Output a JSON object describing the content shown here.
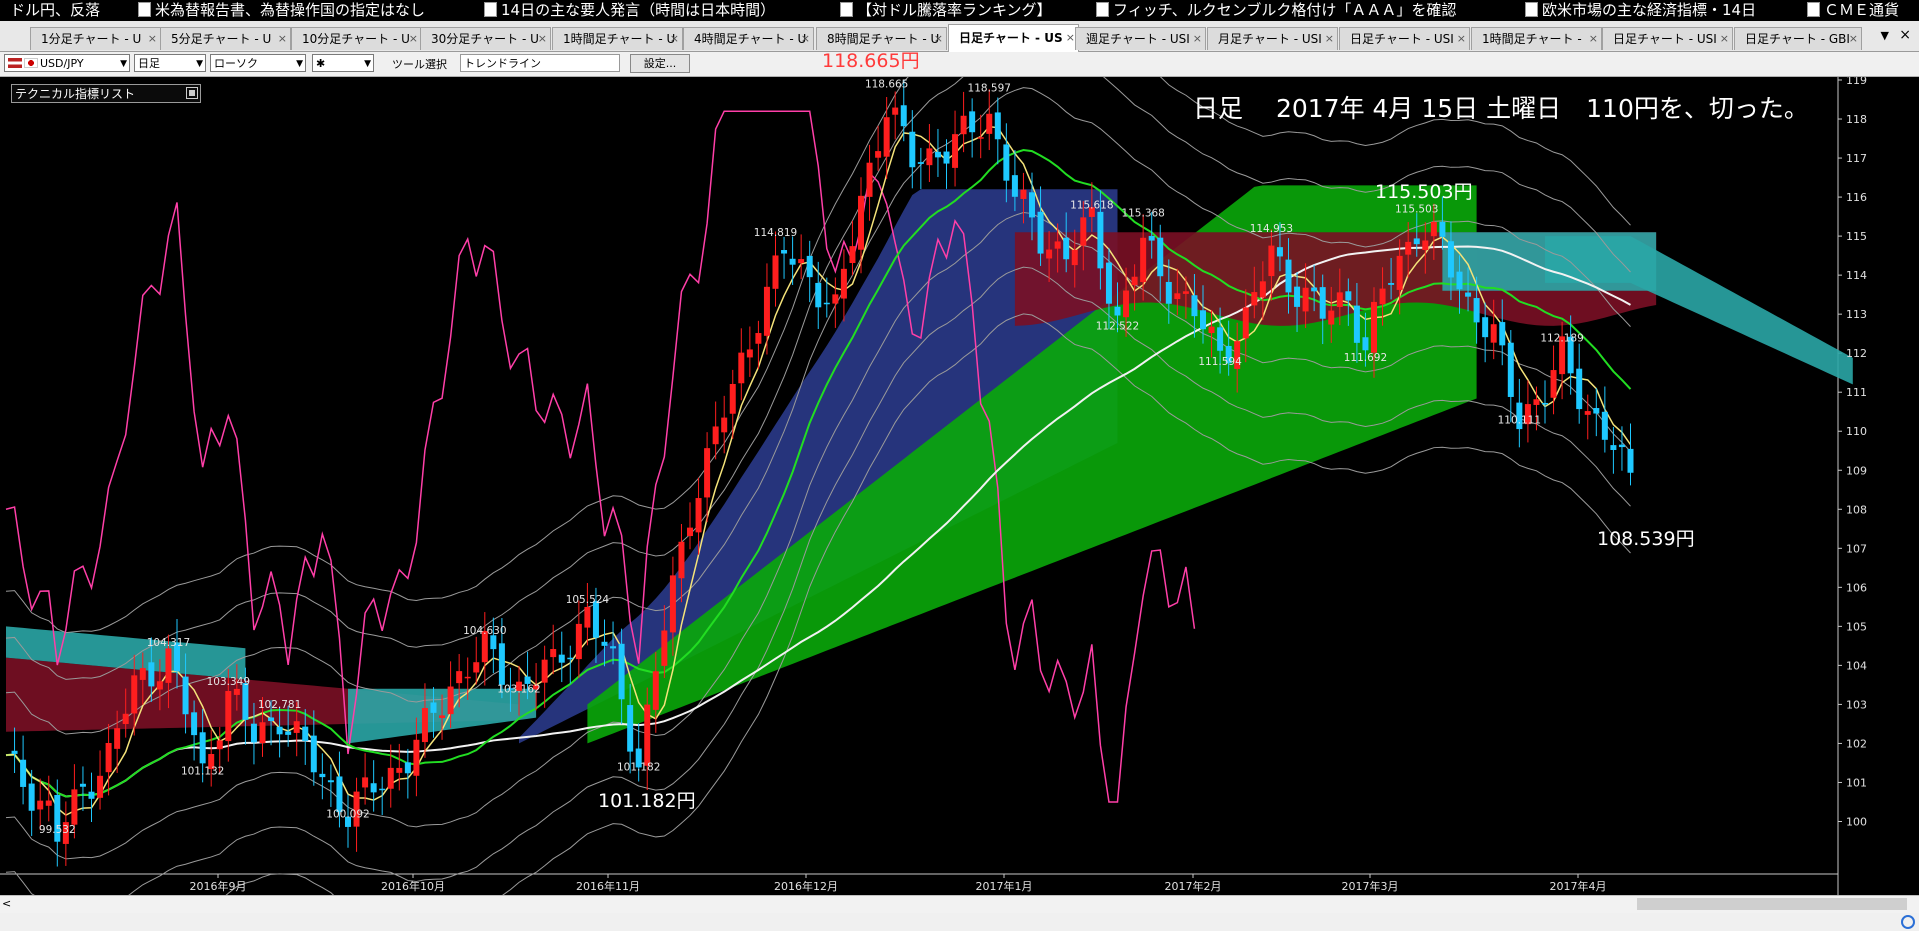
{
  "ticker": [
    {
      "text": "ドル円、反落",
      "icon": false
    },
    {
      "text": "米為替報告書、為替操作国の指定はなし",
      "icon": true
    },
    {
      "text": "14日の主な要人発言（時間は日本時間）",
      "icon": true
    },
    {
      "text": "【対ドル騰落率ランキング】",
      "icon": true
    },
    {
      "text": "フィッチ、ルクセンブルク格付け「ＡＡＡ」を確認",
      "icon": true
    },
    {
      "text": "欧米市場の主な経済指標・14日",
      "icon": true
    },
    {
      "text": "ＣＭＥ通貨",
      "icon": true
    }
  ],
  "tabs": [
    {
      "label": "1分足チャート - U",
      "active": false
    },
    {
      "label": "5分足チャート - U",
      "active": false
    },
    {
      "label": "10分足チャート - U",
      "active": false
    },
    {
      "label": "30分足チャート - U",
      "active": false
    },
    {
      "label": "1時間足チャート - U",
      "active": false
    },
    {
      "label": "4時間足チャート - U",
      "active": false
    },
    {
      "label": "8時間足チャート - U",
      "active": false
    },
    {
      "label": "日足チャート - US",
      "active": true
    },
    {
      "label": "週足チャート - USI",
      "active": false
    },
    {
      "label": "月足チャート - USI",
      "active": false
    },
    {
      "label": "日足チャート - USI",
      "active": false
    },
    {
      "label": "1時間足チャート -",
      "active": false
    },
    {
      "label": "日足チャート - USI",
      "active": false
    },
    {
      "label": "日足チャート - GBI",
      "active": false
    }
  ],
  "tab_close_glyph": "×",
  "tab_menu_glyph": "▼",
  "toolbar": {
    "pair": "USD/JPY",
    "period": "日足",
    "chart_style": "ローソク",
    "line_style": "✱",
    "tool_label": "ツール選択",
    "tool_value": "トレンドライン",
    "settings": "設定..."
  },
  "indicator_panel": {
    "label": "テクニカル指標リスト"
  },
  "annotations": {
    "headline": "日足　 2017年 4月 15日 土曜日　110円を、切った。",
    "high": "118.665円",
    "peak2": "115.503円",
    "low_nov": "101.182円",
    "current": "108.539円"
  },
  "colors": {
    "bull": "#ff1e1e",
    "bear": "#1ec8ff",
    "kumo_up": "#0aa80a",
    "kumo_down": "#7a1025",
    "cloud_blue": "#2a3a8a",
    "cloud_teal": "#2aa6a6",
    "rsi": "#ff3fa8",
    "ma_long": "#f2f2f2",
    "ma_mid": "#22dd22",
    "ma_short": "#f5e37a"
  },
  "chart_data": {
    "type": "candlestick",
    "instrument": "USD/JPY",
    "timeframe": "日足",
    "ylim": [
      99.5,
      119
    ],
    "y_ticks": [
      "100",
      "101",
      "102",
      "103",
      "104",
      "105",
      "106",
      "107",
      "108",
      "109",
      "110",
      "111",
      "112",
      "113",
      "114",
      "115",
      "116",
      "117",
      "118",
      "119"
    ],
    "x_ticks": [
      "2016年9月",
      "2016年10月",
      "2016年11月",
      "2016年12月",
      "2017年1月",
      "2017年2月",
      "2017年3月",
      "2017年4月"
    ],
    "labels": [
      {
        "text": "99.532",
        "at": [
          6,
          99.6
        ]
      },
      {
        "text": "104.317",
        "at": [
          19,
          104.4
        ]
      },
      {
        "text": "103.349",
        "at": [
          26,
          103.4
        ]
      },
      {
        "text": "102.781",
        "at": [
          32,
          102.8
        ]
      },
      {
        "text": "101.132",
        "at": [
          23,
          101.1
        ]
      },
      {
        "text": "100.092",
        "at": [
          40,
          100.0
        ]
      },
      {
        "text": "104.630",
        "at": [
          56,
          104.7
        ]
      },
      {
        "text": "103.162",
        "at": [
          60,
          103.2
        ]
      },
      {
        "text": "105.524",
        "at": [
          68,
          105.5
        ]
      },
      {
        "text": "101.182",
        "at": [
          74,
          101.2
        ]
      },
      {
        "text": "114.819",
        "at": [
          90,
          114.9
        ]
      },
      {
        "text": "118.665",
        "at": [
          103,
          118.7
        ]
      },
      {
        "text": "118.597",
        "at": [
          115,
          118.6
        ]
      },
      {
        "text": "115.618",
        "at": [
          127,
          115.6
        ]
      },
      {
        "text": "115.368",
        "at": [
          133,
          115.4
        ]
      },
      {
        "text": "114.953",
        "at": [
          148,
          115.0
        ]
      },
      {
        "text": "112.522",
        "at": [
          130,
          112.5
        ]
      },
      {
        "text": "111.594",
        "at": [
          142,
          111.6
        ]
      },
      {
        "text": "111.692",
        "at": [
          159,
          111.7
        ]
      },
      {
        "text": "115.503",
        "at": [
          165,
          115.5
        ]
      },
      {
        "text": "112.189",
        "at": [
          182,
          112.2
        ]
      },
      {
        "text": "110.111",
        "at": [
          177,
          110.1
        ]
      }
    ],
    "path_points": [
      [
        0,
        101.5
      ],
      [
        5,
        100.3
      ],
      [
        6,
        99.6
      ],
      [
        9,
        100.8
      ],
      [
        12,
        101.7
      ],
      [
        15,
        103.5
      ],
      [
        19,
        104.2
      ],
      [
        22,
        102.2
      ],
      [
        23,
        101.2
      ],
      [
        26,
        103.3
      ],
      [
        29,
        102.2
      ],
      [
        32,
        102.7
      ],
      [
        36,
        101.5
      ],
      [
        40,
        100.2
      ],
      [
        43,
        100.9
      ],
      [
        47,
        101.6
      ],
      [
        52,
        103.5
      ],
      [
        56,
        104.4
      ],
      [
        60,
        103.4
      ],
      [
        64,
        104.0
      ],
      [
        68,
        105.3
      ],
      [
        71,
        104.0
      ],
      [
        74,
        101.5
      ],
      [
        77,
        105.0
      ],
      [
        80,
        108.0
      ],
      [
        84,
        110.5
      ],
      [
        88,
        113.0
      ],
      [
        91,
        114.6
      ],
      [
        94,
        114.0
      ],
      [
        97,
        113.0
      ],
      [
        100,
        116.0
      ],
      [
        103,
        118.3
      ],
      [
        106,
        117.0
      ],
      [
        110,
        117.2
      ],
      [
        115,
        118.1
      ],
      [
        118,
        116.0
      ],
      [
        121,
        115.0
      ],
      [
        124,
        114.5
      ],
      [
        127,
        115.4
      ],
      [
        130,
        112.8
      ],
      [
        133,
        114.8
      ],
      [
        136,
        113.8
      ],
      [
        139,
        113.0
      ],
      [
        142,
        112.0
      ],
      [
        145,
        112.8
      ],
      [
        148,
        114.6
      ],
      [
        151,
        113.6
      ],
      [
        154,
        113.0
      ],
      [
        157,
        113.5
      ],
      [
        159,
        112.0
      ],
      [
        161,
        113.6
      ],
      [
        163,
        114.4
      ],
      [
        165,
        115.2
      ],
      [
        168,
        114.7
      ],
      [
        171,
        113.3
      ],
      [
        174,
        112.4
      ],
      [
        177,
        110.4
      ],
      [
        180,
        111.0
      ],
      [
        182,
        111.9
      ],
      [
        185,
        110.6
      ],
      [
        188,
        109.6
      ],
      [
        190,
        108.7
      ]
    ],
    "n_bars": 191
  }
}
